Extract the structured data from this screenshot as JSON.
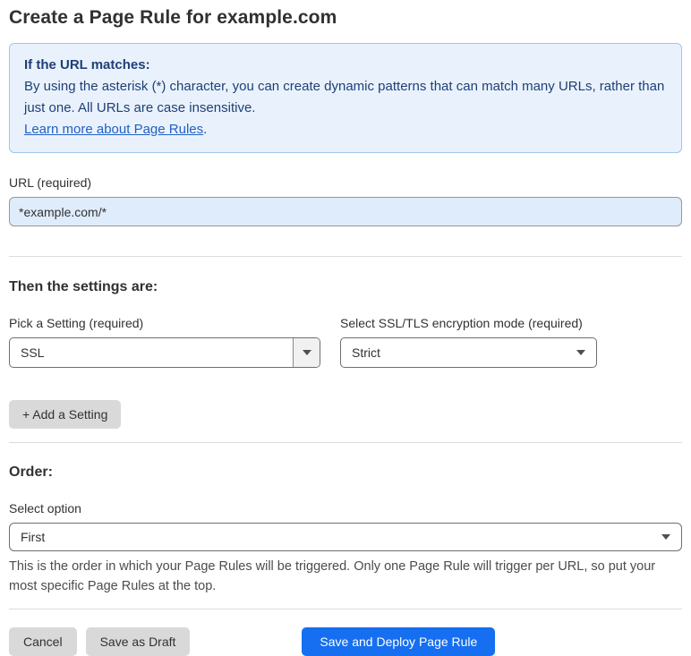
{
  "page": {
    "title": "Create a Page Rule for example.com"
  },
  "info_box": {
    "heading": "If the URL matches:",
    "body": "By using the asterisk (*) character, you can create dynamic patterns that can match many URLs, rather than just one. All URLs are case insensitive.",
    "link_label": "Learn more about Page Rules",
    "link_suffix": "."
  },
  "url_field": {
    "label": "URL (required)",
    "value": "*example.com/*"
  },
  "settings_section": {
    "heading": "Then the settings are:",
    "setting_label": "Pick a Setting (required)",
    "setting_value": "SSL",
    "mode_label": "Select SSL/TLS encryption mode (required)",
    "mode_value": "Strict",
    "add_setting_label": "+ Add a Setting"
  },
  "order_section": {
    "heading": "Order:",
    "select_label": "Select option",
    "select_value": "First",
    "helper_text": "This is the order in which your Page Rules will be triggered. Only one Page Rule will trigger per URL, so put your most specific Page Rules at the top."
  },
  "footer": {
    "cancel_label": "Cancel",
    "save_draft_label": "Save as Draft",
    "save_deploy_label": "Save and Deploy Page Rule"
  },
  "colors": {
    "accent_blue": "#166ff0",
    "info_background": "#e9f2fc",
    "info_border": "#9fc6ec",
    "info_text": "#1f3f77",
    "link_blue": "#2160c4",
    "input_background": "#dfecfb",
    "button_gray": "#d9d9d9"
  }
}
